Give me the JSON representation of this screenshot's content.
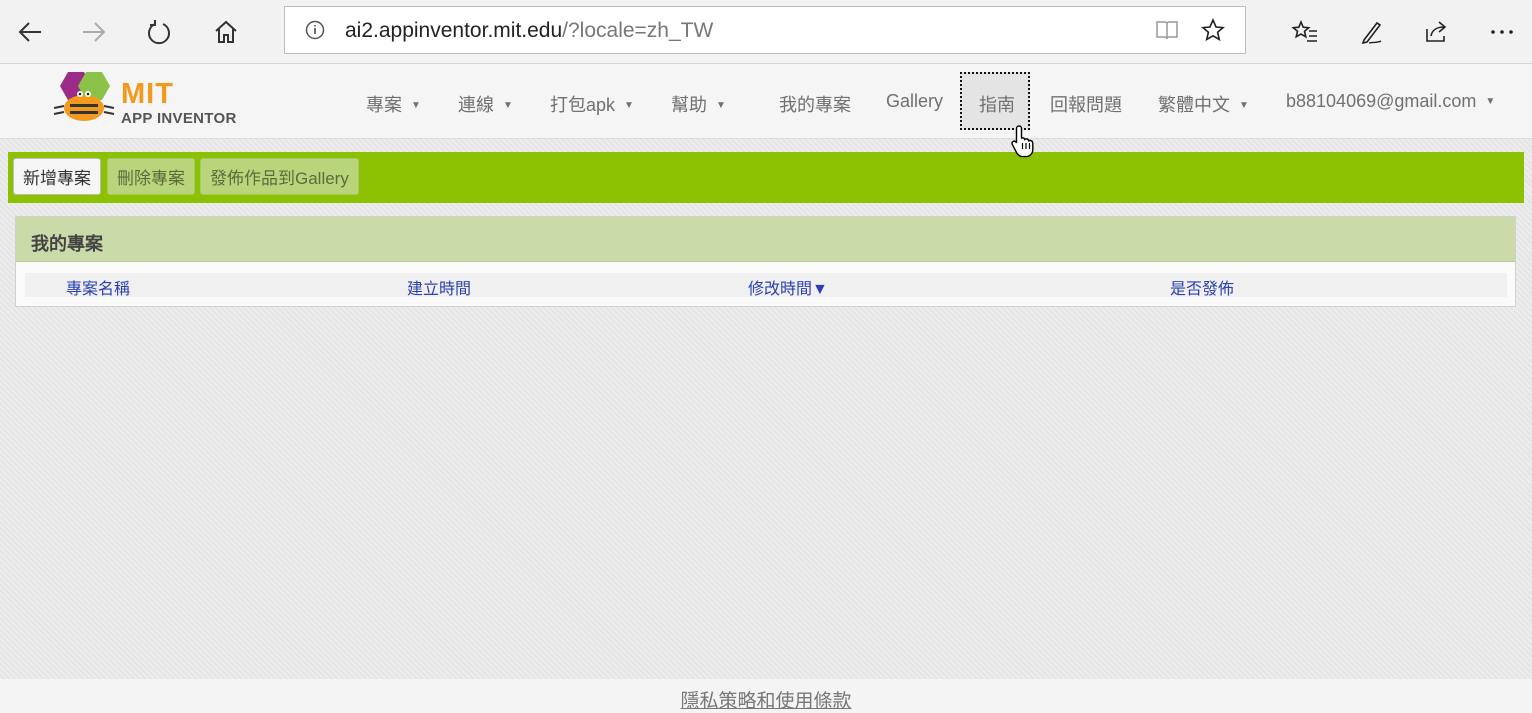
{
  "browser": {
    "url_host": "ai2.appinventor.mit.edu",
    "url_rest": "/?locale=zh_TW",
    "icons": [
      "back-icon",
      "forward-icon",
      "refresh-icon",
      "home-icon",
      "info-icon",
      "reading-view-icon",
      "favorite-star-icon",
      "favorites-list-icon",
      "pen-icon",
      "share-icon",
      "more-icon"
    ]
  },
  "app": {
    "logo": {
      "mit": "MIT",
      "subtitle": "APP INVENTOR"
    },
    "menu": {
      "projects": "專案",
      "connect": "連線",
      "build": "打包apk",
      "help": "幫助",
      "my_projects": "我的專案",
      "gallery": "Gallery",
      "guide": "指南",
      "report": "回報問題",
      "language": "繁體中文",
      "account": "b88104069@gmail.com"
    },
    "toolbar": {
      "new_project": "新增專案",
      "delete_project": "刪除專案",
      "publish_gallery": "發佈作品到Gallery"
    },
    "projects_panel": {
      "title": "我的專案",
      "columns": [
        "專案名稱",
        "建立時間",
        "修改時間▼",
        "是否發佈"
      ]
    },
    "footer": {
      "link": "隱私策略和使用條款"
    },
    "colors": {
      "toolbar_green": "#8bc100",
      "panel_header": "#cadba9",
      "link_blue": "#2a3fb0"
    }
  }
}
